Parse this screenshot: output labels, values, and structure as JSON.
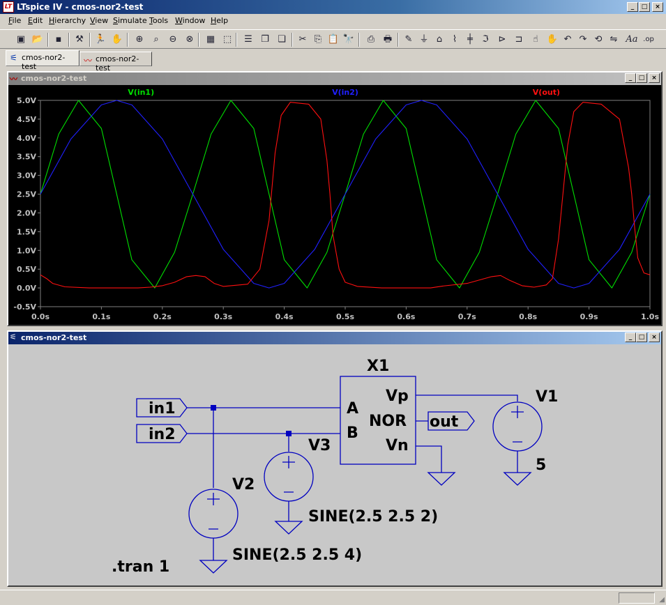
{
  "window": {
    "title": "LTspice IV - cmos-nor2-test",
    "logo": "LT"
  },
  "menu": [
    {
      "label": "File",
      "u": "F",
      "rest": "ile"
    },
    {
      "label": "Edit",
      "u": "E",
      "rest": "dit"
    },
    {
      "label": "Hierarchy",
      "u": "H",
      "rest": "ierarchy"
    },
    {
      "label": "View",
      "u": "V",
      "rest": "iew"
    },
    {
      "label": "Simulate",
      "u": "S",
      "rest": "imulate"
    },
    {
      "label": "Tools",
      "u": "T",
      "rest": "ools"
    },
    {
      "label": "Window",
      "u": "W",
      "rest": "indow"
    },
    {
      "label": "Help",
      "u": "H",
      "rest": "elp"
    }
  ],
  "tabs": [
    {
      "label": "cmos-nor2-test",
      "icon": "schematic-icon"
    },
    {
      "label": "cmos-nor2-test",
      "icon": "waveform-icon"
    }
  ],
  "plot_window": {
    "title": "cmos-nor2-test"
  },
  "schematic_window": {
    "title": "cmos-nor2-test"
  },
  "chart_data": {
    "type": "line",
    "background": "#000000",
    "xlim": [
      0,
      1.0
    ],
    "ylim": [
      -0.5,
      5.0
    ],
    "x_ticks": [
      "0.0s",
      "0.1s",
      "0.2s",
      "0.3s",
      "0.4s",
      "0.5s",
      "0.6s",
      "0.7s",
      "0.8s",
      "0.9s",
      "1.0s"
    ],
    "y_ticks": [
      "5.0V",
      "4.5V",
      "4.0V",
      "3.5V",
      "3.0V",
      "2.5V",
      "2.0V",
      "1.5V",
      "1.0V",
      "0.5V",
      "0.0V",
      "-0.5V"
    ],
    "series": [
      {
        "name": "V(in1)",
        "color": "#00e000",
        "x": [
          0,
          0.03,
          0.0625,
          0.1,
          0.125,
          0.15,
          0.1875,
          0.22,
          0.25,
          0.28,
          0.3125,
          0.35,
          0.375,
          0.4,
          0.4375,
          0.47,
          0.5,
          0.53,
          0.5625,
          0.6,
          0.625,
          0.65,
          0.6875,
          0.72,
          0.75,
          0.78,
          0.8125,
          0.85,
          0.875,
          0.9,
          0.9375,
          0.97,
          1.0
        ],
        "y": [
          2.5,
          4.1,
          5.0,
          4.25,
          2.5,
          0.75,
          0.0,
          0.95,
          2.5,
          4.1,
          5.0,
          4.25,
          2.5,
          0.75,
          0.0,
          0.95,
          2.5,
          4.1,
          5.0,
          4.25,
          2.5,
          0.75,
          0.0,
          0.95,
          2.5,
          4.1,
          5.0,
          4.25,
          2.5,
          0.75,
          0.0,
          0.95,
          2.5
        ]
      },
      {
        "name": "V(in2)",
        "color": "#2020ff",
        "x": [
          0,
          0.05,
          0.1,
          0.125,
          0.15,
          0.2,
          0.25,
          0.3,
          0.35,
          0.375,
          0.4,
          0.45,
          0.5,
          0.55,
          0.6,
          0.625,
          0.65,
          0.7,
          0.75,
          0.8,
          0.85,
          0.875,
          0.9,
          0.95,
          1.0
        ],
        "y": [
          2.5,
          3.97,
          4.88,
          5.0,
          4.88,
          3.97,
          2.5,
          1.03,
          0.12,
          0.0,
          0.12,
          1.03,
          2.5,
          3.97,
          4.88,
          5.0,
          4.88,
          3.97,
          2.5,
          1.03,
          0.12,
          0.0,
          0.12,
          1.03,
          2.5
        ]
      },
      {
        "name": "V(out)",
        "color": "#ff1010",
        "x": [
          0,
          0.01,
          0.02,
          0.04,
          0.08,
          0.12,
          0.16,
          0.18,
          0.2,
          0.22,
          0.24,
          0.255,
          0.27,
          0.285,
          0.3,
          0.34,
          0.36,
          0.375,
          0.385,
          0.395,
          0.41,
          0.44,
          0.46,
          0.47,
          0.475,
          0.48,
          0.49,
          0.5,
          0.52,
          0.56,
          0.6,
          0.64,
          0.66,
          0.7,
          0.74,
          0.755,
          0.77,
          0.79,
          0.81,
          0.83,
          0.84,
          0.85,
          0.865,
          0.875,
          0.89,
          0.92,
          0.95,
          0.965,
          0.97,
          0.975,
          0.98,
          0.99,
          1.0
        ],
        "y": [
          0.35,
          0.25,
          0.12,
          0.03,
          0.0,
          0.0,
          0.0,
          0.02,
          0.06,
          0.15,
          0.3,
          0.33,
          0.3,
          0.12,
          0.04,
          0.1,
          0.5,
          1.8,
          3.6,
          4.6,
          4.95,
          4.9,
          4.5,
          3.4,
          2.5,
          1.4,
          0.5,
          0.15,
          0.04,
          0.0,
          0.0,
          0.0,
          0.05,
          0.12,
          0.3,
          0.33,
          0.2,
          0.06,
          0.02,
          0.08,
          0.25,
          1.3,
          3.8,
          4.7,
          4.95,
          4.9,
          4.5,
          3.2,
          2.5,
          1.6,
          0.8,
          0.4,
          0.35
        ]
      }
    ]
  },
  "schematic": {
    "labels": {
      "x1": "X1",
      "pin_a": "A",
      "pin_b": "B",
      "pin_vp": "Vp",
      "pin_nor": "NOR",
      "pin_vn": "Vn",
      "net_in1": "in1",
      "net_in2": "in2",
      "net_out": "out",
      "v1": "V1",
      "v1_value": "5",
      "v2": "V2",
      "v2_value": "SINE(2.5 2.5 4)",
      "v3": "V3",
      "v3_value": "SINE(2.5 2.5 2)",
      "directive": ".tran 1"
    },
    "wire_color": "#0000c0",
    "background": "#c8c8c8"
  }
}
